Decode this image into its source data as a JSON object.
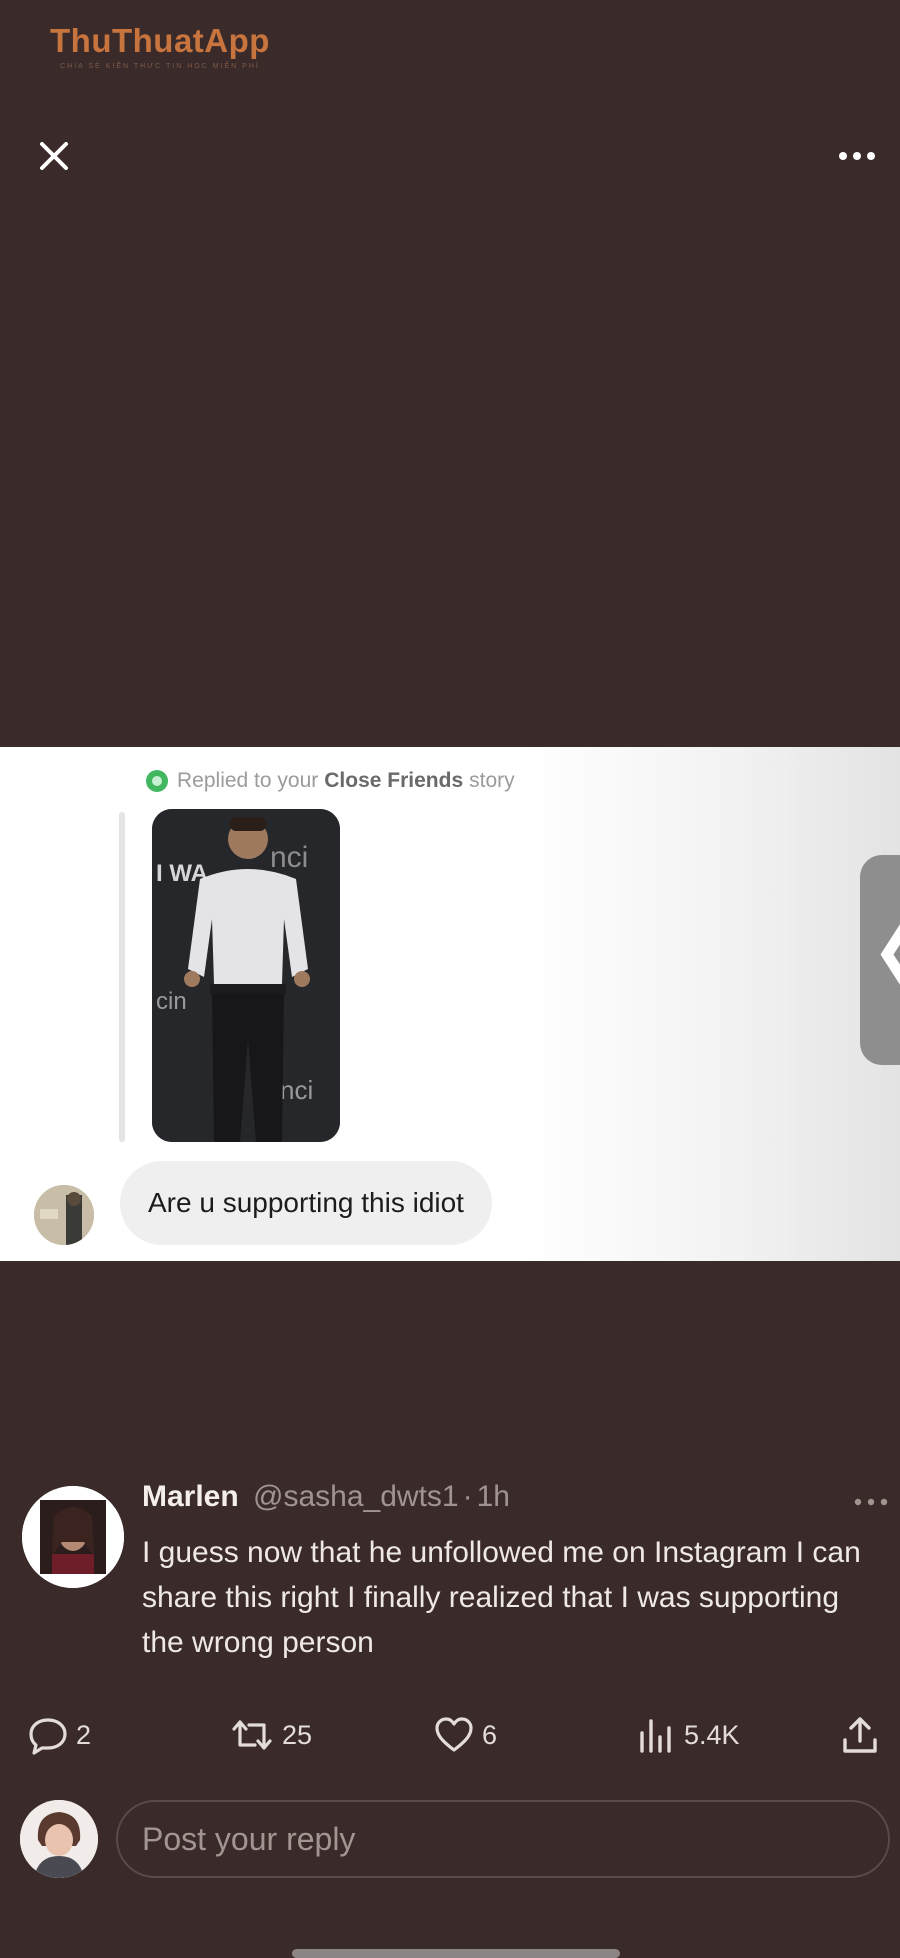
{
  "watermark": {
    "title": "ThuThuatApp",
    "subtitle": "CHIA SẺ KIẾN THỨC TIN HỌC MIỄN PHÍ"
  },
  "top_bar": {
    "close_icon": "close-icon",
    "more_icon": "more-horizontal-icon"
  },
  "media": {
    "story_label_prefix": "Replied to your",
    "story_label_bold": "Close Friends",
    "story_label_suffix": "story",
    "thumbnail_text": "I WA",
    "message": "Are u supporting this idiot",
    "edge_handle_glyph": "❮"
  },
  "tweet": {
    "name": "Marlen",
    "handle": "@sasha_dwts1",
    "separator": "·",
    "time": "1h",
    "text": "I guess now that he unfollowed me on Instagram I can share this right I finally realized that I was supporting the wrong person"
  },
  "actions": {
    "replies": "2",
    "retweets": "25",
    "likes": "6",
    "views": "5.4K"
  },
  "reply": {
    "placeholder": "Post your reply"
  },
  "colors": {
    "background": "#3a2b2a",
    "green_status": "#41b760",
    "watermark": "#c8743e"
  }
}
